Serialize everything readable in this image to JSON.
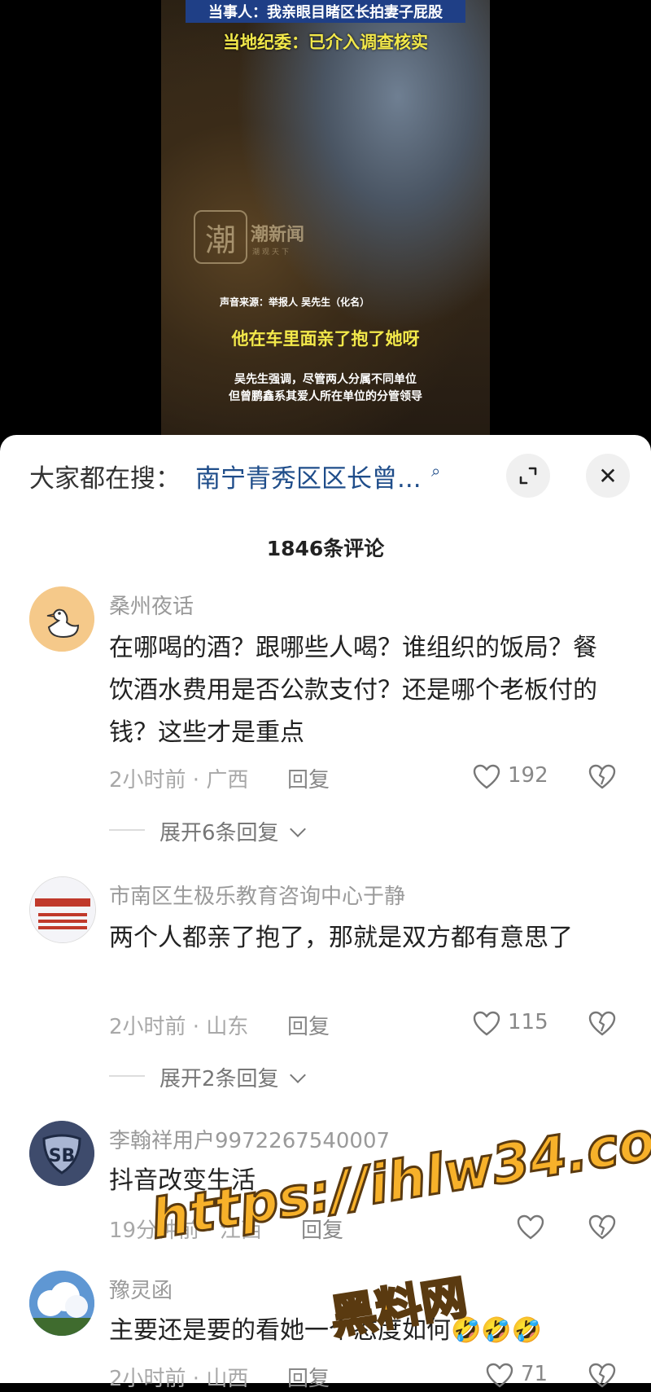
{
  "video": {
    "top_title": "当事人：我亲眼目睹区长拍妻子屁股",
    "sub_title": "当地纪委：已介入调查核实",
    "logo_char": "潮",
    "logo_name": "潮新闻",
    "logo_slogan": "潮观天下",
    "source_line": "声音来源：举报人 吴先生（化名）",
    "quote": "他在车里面亲了抱了她呀",
    "note_line1": "吴先生强调，尽管两人分属不同单位",
    "note_line2": "但曾鹏鑫系其爱人所在单位的分管领导"
  },
  "search": {
    "prefix": "大家都在搜：",
    "query": "南宁青秀区区长曾...",
    "expand_icon": "expand-icon",
    "close_symbol": "✕"
  },
  "comments_header": {
    "count_label": "1846条评论"
  },
  "comments": [
    {
      "username": "桑州夜话",
      "text": "在哪喝的酒？跟哪些人喝？谁组织的饭局？餐饮酒水费用是否公款支付？还是哪个老板付的钱？这些才是重点",
      "meta": "2小时前 · 广西",
      "reply_label": "回复",
      "likes": "192",
      "expand_label": "展开6条回复"
    },
    {
      "username": "市南区生极乐教育咨询中心于静",
      "text": "两个人都亲了抱了，那就是双方都有意思了",
      "meta": "2小时前 · 山东",
      "reply_label": "回复",
      "likes": "115",
      "expand_label": "展开2条回复"
    },
    {
      "username": "李翰祥用户9972267540007",
      "text": "抖音改变生活",
      "meta": "19分钟前 · 江西",
      "reply_label": "回复",
      "likes": ""
    },
    {
      "username": "豫灵函",
      "text": "主要还是要的看她一个态度如何🤣🤣🤣",
      "meta": "2小时前 · 山西",
      "reply_label": "回复",
      "likes": "71"
    }
  ],
  "watermark": {
    "url": "https://ihlw34.com",
    "brand": "黑料网"
  },
  "colors": {
    "accent_link": "#1f4d8a",
    "watermark": "#f7b12a",
    "banner": "#1f3f86"
  }
}
